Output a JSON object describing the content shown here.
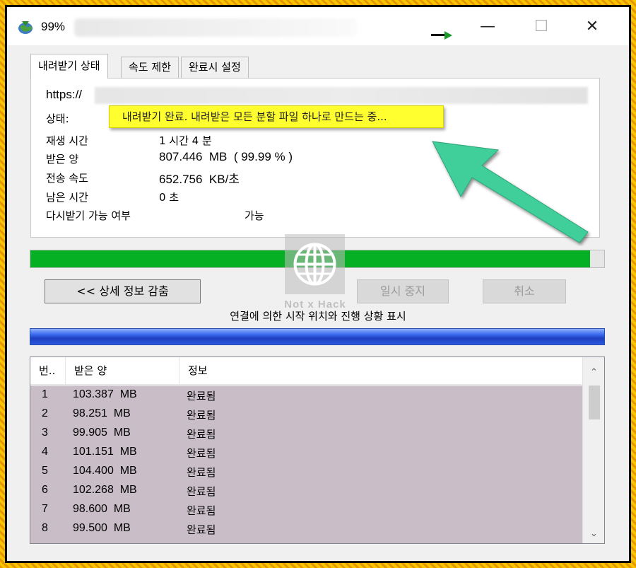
{
  "window": {
    "title": "99%",
    "minimize_glyph": "—",
    "maximize_glyph": "☐",
    "close_glyph": "✕"
  },
  "tabs": [
    {
      "label": "내려받기 상태",
      "active": true
    },
    {
      "label": "속도 제한",
      "active": false
    },
    {
      "label": "완료시 설정",
      "active": false
    }
  ],
  "status_panel": {
    "url_label": "https://",
    "status_label": "상태:",
    "status_value": "내려받기 완료. 내려받은 모든 분할 파일 하나로 만드는 중...",
    "fields": [
      {
        "label": "재생 시간",
        "value": "1 시간 4 분"
      },
      {
        "label": "받은 양",
        "value": "807.446  MB  ( 99.99 % )"
      },
      {
        "label": "전송 속도",
        "value": "652.756  KB/초"
      },
      {
        "label": "남은 시간",
        "value": "0 초"
      },
      {
        "label": "다시받기 가능 여부",
        "value": "가능"
      }
    ]
  },
  "progress": {
    "percent": 99.99,
    "color": "#06b025"
  },
  "buttons": {
    "details": "<< 상세 정보 감춤",
    "pause": "일시 중지",
    "cancel": "취소"
  },
  "connections_label": "연결에 의한 시작 위치와 진행 상황 표시",
  "table": {
    "columns": [
      "번..",
      "받은 양",
      "정보"
    ],
    "rows": [
      [
        "1",
        "103.387  MB",
        "완료됨"
      ],
      [
        "2",
        "98.251  MB",
        "완료됨"
      ],
      [
        "3",
        "99.905  MB",
        "완료됨"
      ],
      [
        "4",
        "101.151  MB",
        "완료됨"
      ],
      [
        "5",
        "104.400  MB",
        "완료됨"
      ],
      [
        "6",
        "102.268  MB",
        "완료됨"
      ],
      [
        "7",
        "98.600  MB",
        "완료됨"
      ],
      [
        "8",
        "99.500  MB",
        "완료됨"
      ]
    ]
  },
  "watermark": {
    "text": "Not x Hack"
  },
  "colors": {
    "highlight": "#ffff30",
    "annotation_arrow": "#3fcf9a",
    "table_row_bg": "#c9bec7",
    "connection_bar": "#2a5ae0"
  },
  "icons": [
    "app-globe-icon",
    "scroll-up-icon",
    "scroll-down-icon",
    "globe-watermark-icon",
    "annotation-arrow-icon"
  ]
}
